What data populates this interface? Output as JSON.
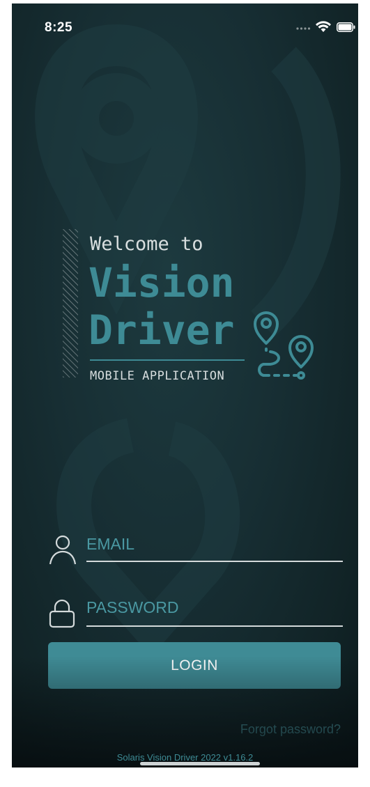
{
  "status_bar": {
    "time": "8:25",
    "signal_icon": "cellular-dots-icon",
    "wifi_icon": "wifi-icon",
    "battery_icon": "battery-icon"
  },
  "logo": {
    "welcome": "Welcome to",
    "brand_line_1": "Vision",
    "brand_line_2": "Driver",
    "subtitle": "MOBILE APPLICATION",
    "route_icon": "route-pins-icon"
  },
  "form": {
    "email": {
      "placeholder": "EMAIL",
      "value": "",
      "icon": "user-icon"
    },
    "password": {
      "placeholder": "PASSWORD",
      "value": "",
      "icon": "lock-icon"
    },
    "login_label": "LOGIN",
    "forgot_label": "Forgot password?"
  },
  "footer": {
    "version": "Solaris Vision Driver 2022 v1.16.2"
  },
  "colors": {
    "background": "#172e33",
    "accent": "#3f8b95",
    "placeholder": "#4a98a2",
    "text": "#ffffff"
  }
}
